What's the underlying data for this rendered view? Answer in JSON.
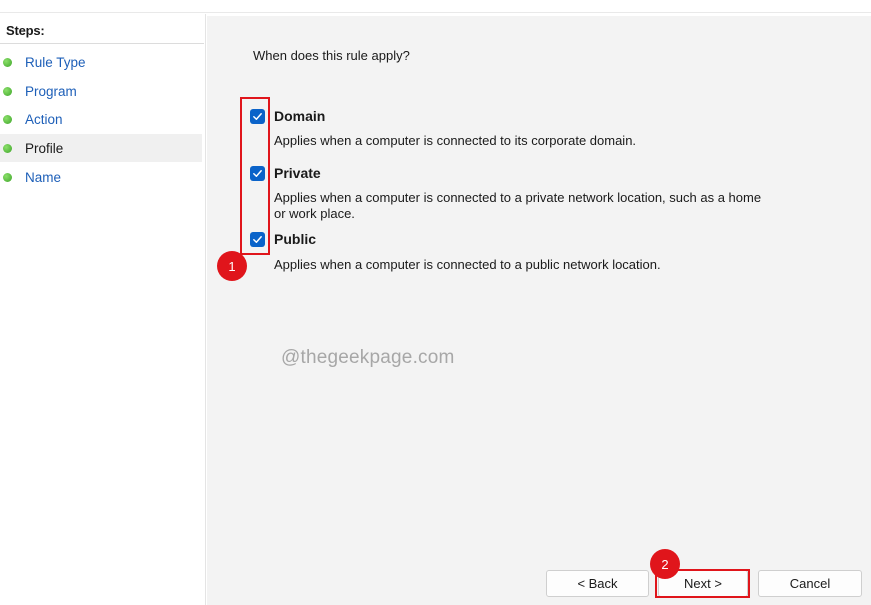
{
  "sidebar": {
    "title": "Steps:",
    "items": [
      {
        "label": "Rule Type",
        "current": false
      },
      {
        "label": "Program",
        "current": false
      },
      {
        "label": "Action",
        "current": false
      },
      {
        "label": "Profile",
        "current": true
      },
      {
        "label": "Name",
        "current": false
      }
    ]
  },
  "main": {
    "question": "When does this rule apply?",
    "options": [
      {
        "title": "Domain",
        "checked": true,
        "description": "Applies when a computer is connected to its corporate domain."
      },
      {
        "title": "Private",
        "checked": true,
        "description_line1": "Applies when a computer is connected to a private network location, such as a home",
        "description_line2": "or work place."
      },
      {
        "title": "Public",
        "checked": true,
        "description": "Applies when a computer is connected to a public network location."
      }
    ],
    "watermark": "@thegeekpage.com"
  },
  "annotations": {
    "badge1": "1",
    "badge2": "2",
    "color": "#e0151b"
  },
  "buttons": {
    "back": "< Back",
    "next": "Next >",
    "cancel": "Cancel"
  },
  "colors": {
    "accent": "#0a63c9",
    "link": "#1d5fb8",
    "step_dot": "#3fa52a"
  }
}
